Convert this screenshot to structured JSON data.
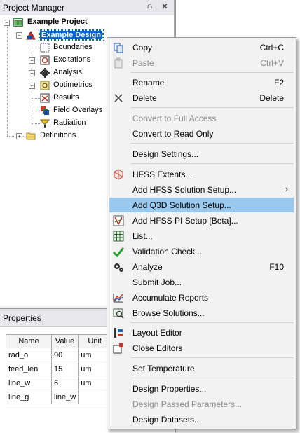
{
  "project_manager": {
    "title": "Project Manager",
    "pin_glyph": "⩍",
    "close_glyph": "✕",
    "tree": {
      "project": "Example Project",
      "design": "Example Design",
      "children": [
        "Boundaries",
        "Excitations",
        "Analysis",
        "Optimetrics",
        "Results",
        "Field Overlays",
        "Radiation"
      ],
      "definitions": "Definitions"
    }
  },
  "properties": {
    "title": "Properties",
    "columns": [
      "Name",
      "Value",
      "Unit"
    ],
    "rows": [
      {
        "name": "rad_o",
        "value": "90",
        "unit": "um"
      },
      {
        "name": "feed_len",
        "value": "15",
        "unit": "um"
      },
      {
        "name": "line_w",
        "value": "6",
        "unit": "um"
      },
      {
        "name": "line_g",
        "value": "line_w",
        "unit": ""
      }
    ]
  },
  "context_menu": {
    "copy": {
      "label": "Copy",
      "shortcut": "Ctrl+C"
    },
    "paste": {
      "label": "Paste",
      "shortcut": "Ctrl+V"
    },
    "rename": {
      "label": "Rename",
      "shortcut": "F2"
    },
    "delete": {
      "label": "Delete",
      "shortcut": "Delete"
    },
    "convert_full": {
      "label": "Convert to Full Access"
    },
    "convert_readonly": {
      "label": "Convert to Read Only"
    },
    "design_settings": {
      "label": "Design Settings..."
    },
    "hfss_extents": {
      "label": "HFSS Extents..."
    },
    "add_hfss_setup": {
      "label": "Add HFSS Solution Setup..."
    },
    "add_q3d_setup": {
      "label": "Add Q3D Solution Setup..."
    },
    "add_pi_setup": {
      "label": "Add HFSS PI Setup [Beta]..."
    },
    "list": {
      "label": "List..."
    },
    "validation": {
      "label": "Validation Check..."
    },
    "analyze": {
      "label": "Analyze",
      "shortcut": "F10"
    },
    "submit_job": {
      "label": "Submit Job..."
    },
    "accumulate_reports": {
      "label": "Accumulate Reports"
    },
    "browse_solutions": {
      "label": "Browse Solutions..."
    },
    "layout_editor": {
      "label": "Layout Editor"
    },
    "close_editors": {
      "label": "Close Editors"
    },
    "set_temperature": {
      "label": "Set Temperature"
    },
    "design_properties": {
      "label": "Design Properties..."
    },
    "passed_parameters": {
      "label": "Design Passed Parameters..."
    },
    "design_datasets": {
      "label": "Design Datasets..."
    }
  }
}
